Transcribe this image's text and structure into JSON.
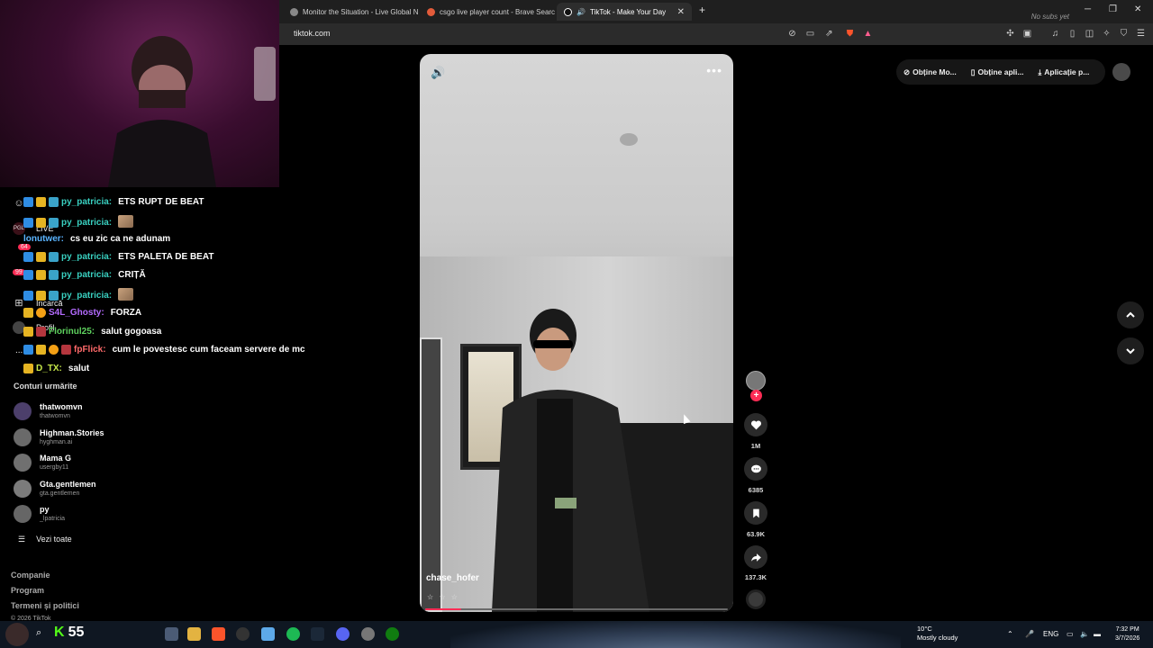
{
  "browser": {
    "tabs": [
      {
        "label": "Monitor the Situation - Live Global N",
        "active": false
      },
      {
        "label": "csgo live player count - Brave Search",
        "active": false
      },
      {
        "label": "TikTok - Make Your Day",
        "active": true
      }
    ],
    "new_tab": "+",
    "no_subs": "No subs yet",
    "url": "tiktok.com"
  },
  "chat": [
    {
      "user": "py_patricia:",
      "user_color": "#39d0c0",
      "text": "ETS RUPT DE BEAT",
      "emote": false
    },
    {
      "user": "py_patricia:",
      "user_color": "#39d0c0",
      "text": "",
      "emote": true
    },
    {
      "user": "lonutwer:",
      "user_color": "#5ab4ff",
      "text": "cs eu zic ca ne adunam",
      "emote": false
    },
    {
      "user": "py_patricia:",
      "user_color": "#39d0c0",
      "text": "ETS PALETA DE BEAT",
      "emote": false
    },
    {
      "user": "py_patricia:",
      "user_color": "#39d0c0",
      "text": "CRIȚĂ",
      "emote": false
    },
    {
      "user": "py_patricia:",
      "user_color": "#39d0c0",
      "text": "",
      "emote": true
    },
    {
      "user": "S4L_Ghosty:",
      "user_color": "#b46bff",
      "text": "FORZA",
      "emote": false
    },
    {
      "user": "Florinul25:",
      "user_color": "#5fd35f",
      "text": "salut gogoasa",
      "emote": false
    },
    {
      "user": "fpFlick:",
      "user_color": "#ff6a6a",
      "text": "cum le povestesc cum faceam servere de mc",
      "emote": false
    },
    {
      "user": "D_TX:",
      "user_color": "#c7e84a",
      "text": "salut",
      "emote": false
    }
  ],
  "sidebar": {
    "live": "LIVE",
    "live_badge": "64",
    "msg_badge": "99",
    "upload": "Încarcă",
    "profile": "Profil",
    "more": "...",
    "following_title": "Conturi urmărite",
    "following": [
      {
        "name": "thatwomvn",
        "handle": "thatwomvn"
      },
      {
        "name": "Highman.Stories",
        "handle": "hyghman.ai"
      },
      {
        "name": "Mama G",
        "handle": "usergby11"
      },
      {
        "name": "Gta.gentlemen",
        "handle": "gta.gentlemen"
      },
      {
        "name": "py",
        "handle": "_lpatricia"
      }
    ],
    "see_all": "Vezi toate",
    "footer": [
      "Companie",
      "Program",
      "Termeni și politici"
    ],
    "copyright": "© 2026 TikTok"
  },
  "video": {
    "author": "chase_hofer",
    "stars": "☆ ☆ ☆",
    "progress": 0.12,
    "likes": "1M",
    "comments": "6385",
    "saves": "63.9K",
    "shares": "137.3K"
  },
  "header": {
    "items": [
      "Obține Mo...",
      "Obține apli...",
      "Aplicație p..."
    ]
  },
  "taskbar": {
    "score_k": "K",
    "score": "55",
    "temp": "10°C",
    "weather": "Mostly cloudy",
    "lang": "ENG",
    "time": "7:32 PM",
    "date": "3/7/2026"
  }
}
